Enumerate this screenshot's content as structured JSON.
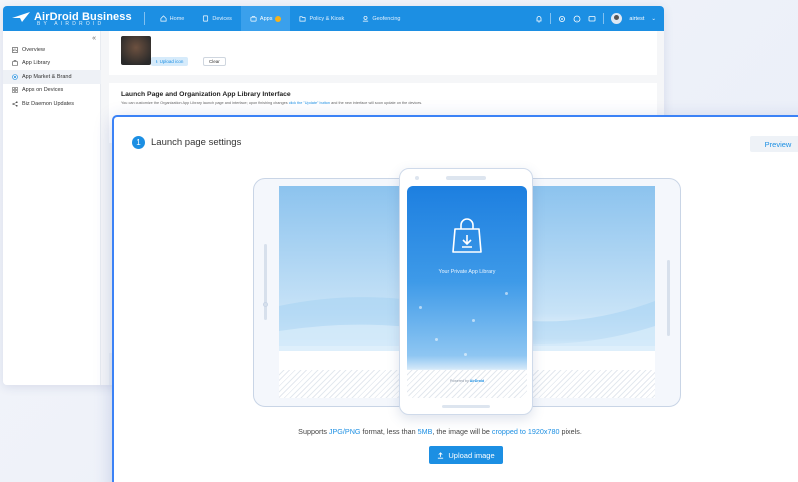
{
  "app": {
    "logo_title": "AirDroid Business",
    "logo_sub": "BY AIRDROID",
    "nav": [
      {
        "label": "Home",
        "icon": "home-icon"
      },
      {
        "label": "Devices",
        "icon": "devices-icon"
      },
      {
        "label": "Apps",
        "icon": "apps-icon"
      },
      {
        "label": "Policy & Kiosk",
        "icon": "folder-icon"
      },
      {
        "label": "Geofencing",
        "icon": "geofence-icon"
      }
    ],
    "user_name": "airtest"
  },
  "sidebar": {
    "items": [
      {
        "label": "Overview",
        "icon": "overview-icon"
      },
      {
        "label": "App Library",
        "icon": "library-icon"
      },
      {
        "label": "App Market & Brand",
        "icon": "market-icon"
      },
      {
        "label": "Apps on Devices",
        "icon": "grid-icon"
      },
      {
        "label": "Biz Daemon Updates",
        "icon": "share-icon"
      }
    ]
  },
  "card1": {
    "upload_icon_label": "Upload icon",
    "clear_label": "Clear"
  },
  "card2": {
    "title": "Launch Page and Organization App Library Interface",
    "desc_before": "You can customize the Organization App Library launch page and interface; upon finishing changes",
    "desc_link": "click the \"Update\" button",
    "desc_after": "and the new interface will soon update on the devices."
  },
  "panel": {
    "step_number": "1",
    "step_title": "Launch page settings",
    "preview_label": "Preview",
    "phone_label": "Your Private App Library",
    "powered_prefix": "Powered by",
    "powered_brand": "AirDroid",
    "support_1": "Supports ",
    "support_format": "JPG/PNG",
    "support_2": " format, less than ",
    "support_size": "5MB",
    "support_3": ", the image will be ",
    "support_crop": "cropped to 1920x780",
    "support_4": " pixels.",
    "upload_image_label": "Upload image"
  },
  "colors": {
    "brand_blue": "#1c8fe3",
    "panel_border": "#3b82f6",
    "badge": "#f7b21b"
  }
}
